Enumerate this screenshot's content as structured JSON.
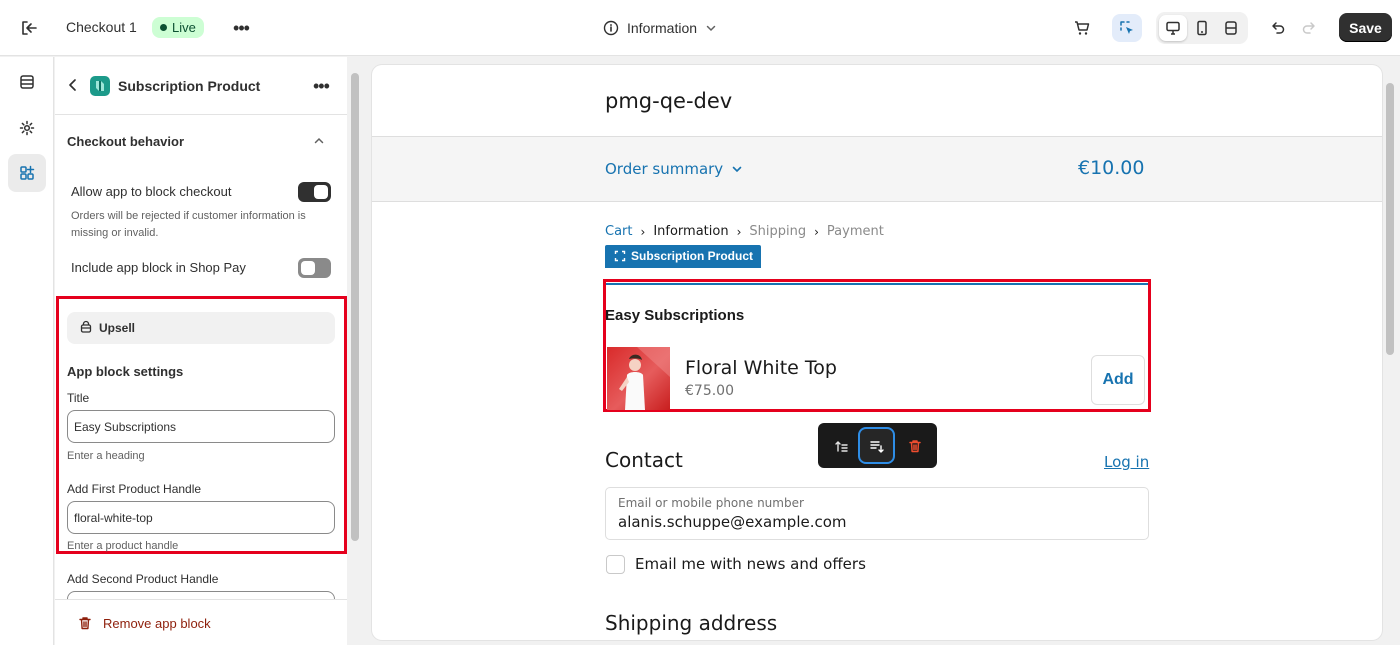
{
  "topbar": {
    "checkout_name": "Checkout 1",
    "status": "Live",
    "page_selector": "Information",
    "save_label": "Save"
  },
  "panel": {
    "title": "Subscription Product",
    "section": "Checkout behavior",
    "allow_block_label": "Allow app to block checkout",
    "allow_block_help": "Orders will be rejected if customer information is missing or invalid.",
    "shop_pay_label": "Include app block in Shop Pay",
    "block_type": "Upsell",
    "settings_heading": "App block settings",
    "title_label": "Title",
    "title_value": "Easy Subscriptions",
    "title_hint": "Enter a heading",
    "first_handle_label": "Add First Product Handle",
    "first_handle_value": "floral-white-top",
    "first_handle_hint": "Enter a product handle",
    "second_handle_label": "Add Second Product Handle",
    "remove_label": "Remove app block"
  },
  "preview": {
    "shop_name": "pmg-qe-dev",
    "order_summary": "Order summary",
    "order_total": "€10.00",
    "breadcrumb": {
      "cart": "Cart",
      "information": "Information",
      "shipping": "Shipping",
      "payment": "Payment"
    },
    "block_tag": "Subscription Product",
    "upsell_title": "Easy Subscriptions",
    "product_name": "Floral White Top",
    "product_price": "€75.00",
    "add_label": "Add",
    "contact_title": "Contact",
    "login_label": "Log in",
    "email_label": "Email or mobile phone number",
    "email_value": "alanis.schuppe@example.com",
    "newsletter_label": "Email me with news and offers",
    "shipping_title": "Shipping address"
  },
  "colors": {
    "accent": "#1773b0",
    "highlight": "#e5001d",
    "live_bg": "#cdfed4",
    "live_text": "#0c5132",
    "destructive": "#8e1f0b"
  }
}
